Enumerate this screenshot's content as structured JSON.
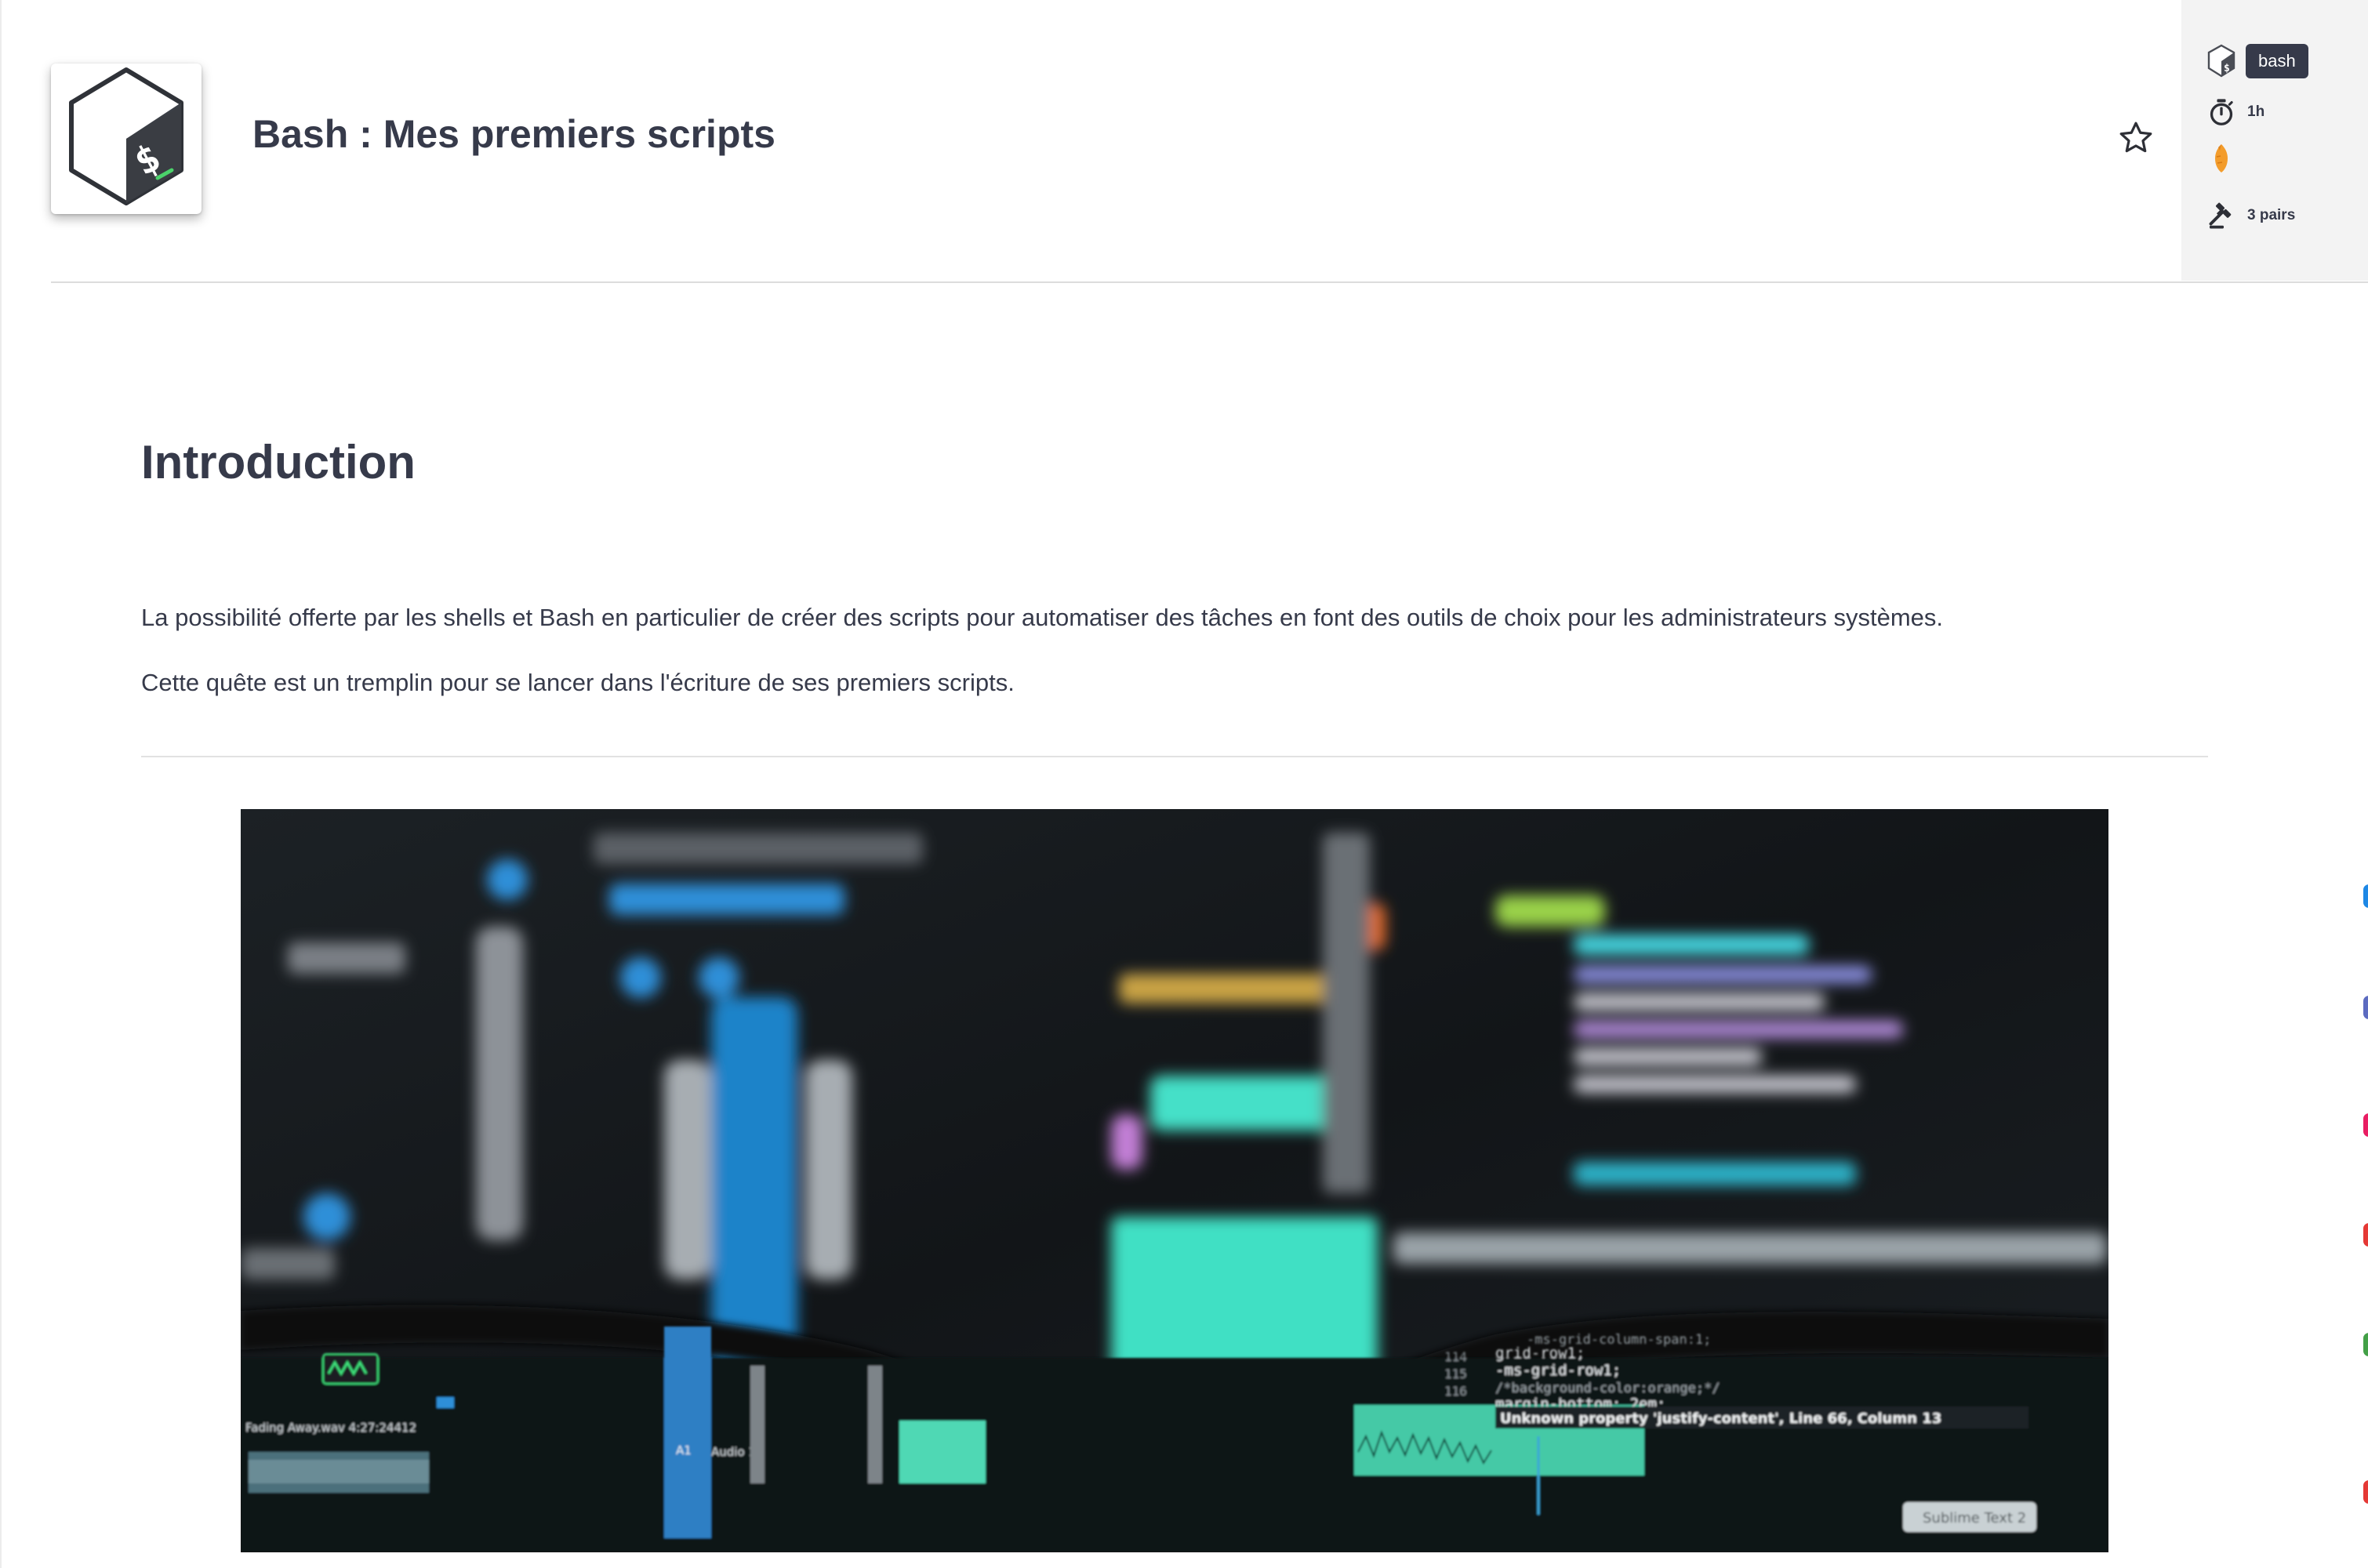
{
  "quest": {
    "title": "Bash : Mes premiers scripts",
    "logo_icon": "bash-logo-icon",
    "favorite_icon": "star-outline-icon"
  },
  "meta": {
    "tag": "bash",
    "duration": "1h",
    "review": "3 pairs",
    "icons": [
      "bash-logo-icon",
      "stopwatch-icon",
      "carrot-icon",
      "gavel-icon"
    ]
  },
  "content": {
    "section_title": "Introduction",
    "paragraphs": [
      "La possibilité offerte par les shells et Bash en particulier de créer des scripts pour automatiser des tâches en font des outils de choix pour les administrateurs systèmes.",
      "Cette quête est un tremplin pour se lancer dans l'écriture de ses premiers scripts."
    ]
  },
  "illustration": {
    "visible_text": [
      "Unknown property 'justify-content', Line 66, Column 13",
      "Sublime Text 2",
      "Fading Away.wav  4:27:24412",
      "Audio 1",
      "grid-row1;",
      "-ms-grid-row1;",
      "/*background-color:orange;*/",
      "margin-bottom: 2em;",
      "-ms-grid-column-span:1;",
      "114",
      "115",
      "116"
    ]
  },
  "colors": {
    "text": "#363a4a",
    "panel_bg": "#f3f3f3",
    "chip_bg": "#363a4a",
    "carrot": "#f39c2b",
    "edge_dots": [
      "#1e88e5",
      "#5c6bc0",
      "#e91e63",
      "#43a047",
      "#e53935"
    ]
  }
}
